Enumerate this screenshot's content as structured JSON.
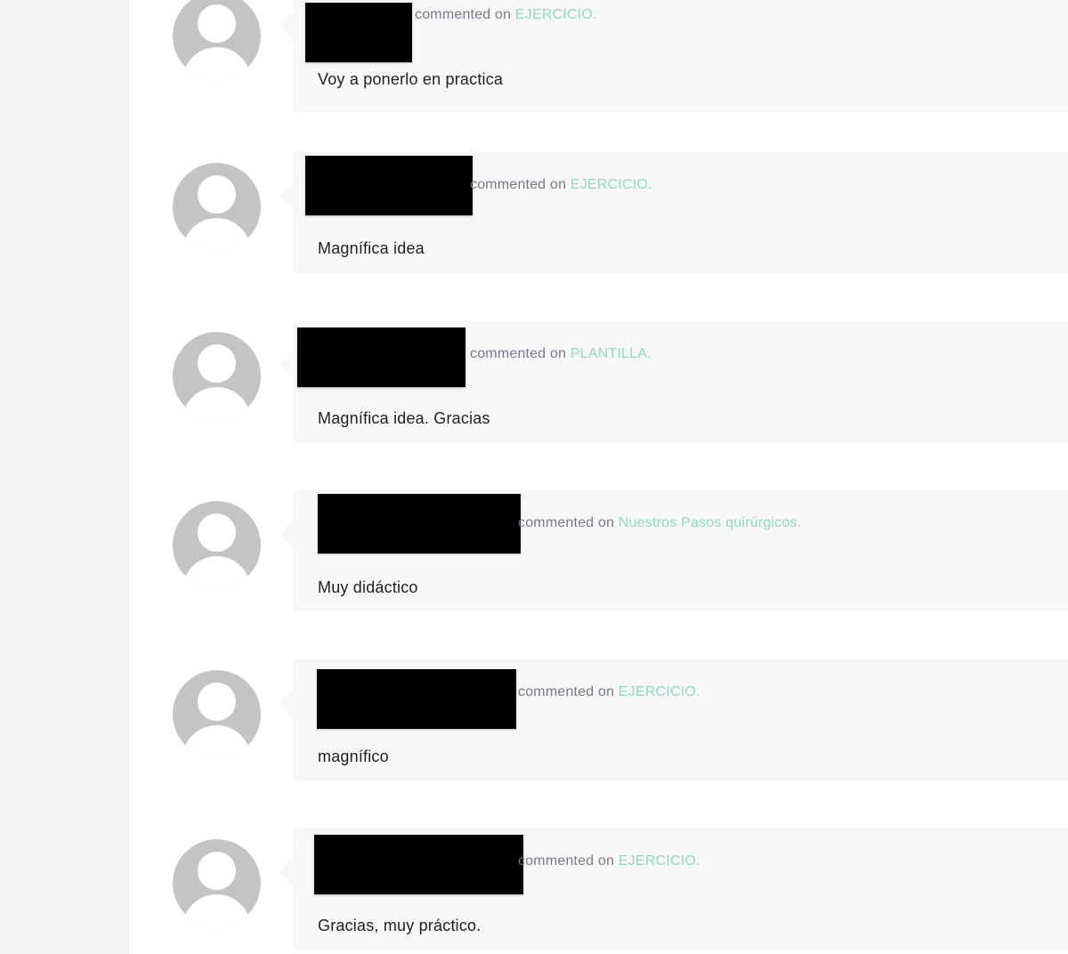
{
  "comments": [
    {
      "commented_on": "commented on",
      "post_title": "EJERCICIO.",
      "text": "Voy a ponerlo en practica"
    },
    {
      "commented_on": "commented on",
      "post_title": "EJERCICIO.",
      "text": "Magnífica idea"
    },
    {
      "commented_on": "commented on",
      "post_title": "PLANTILLA.",
      "text": "Magnífica idea. Gracias"
    },
    {
      "commented_on": "commented on",
      "post_title": "Nuestros Pasos quirúrgicos.",
      "text": "Muy didáctico"
    },
    {
      "commented_on": "commented on",
      "post_title": "EJERCICIO.",
      "text": "magnífico"
    },
    {
      "commented_on": "commented on",
      "post_title": "EJERCICIO.",
      "text": "Gracias, muy práctico."
    }
  ],
  "colors": {
    "link": "#8fd9c3",
    "meta": "#777b87",
    "bubble": "#f7f7f7",
    "avatar": "#c4c4c4",
    "redaction": "#000000"
  },
  "icons": {
    "avatar": "default-avatar-icon"
  }
}
